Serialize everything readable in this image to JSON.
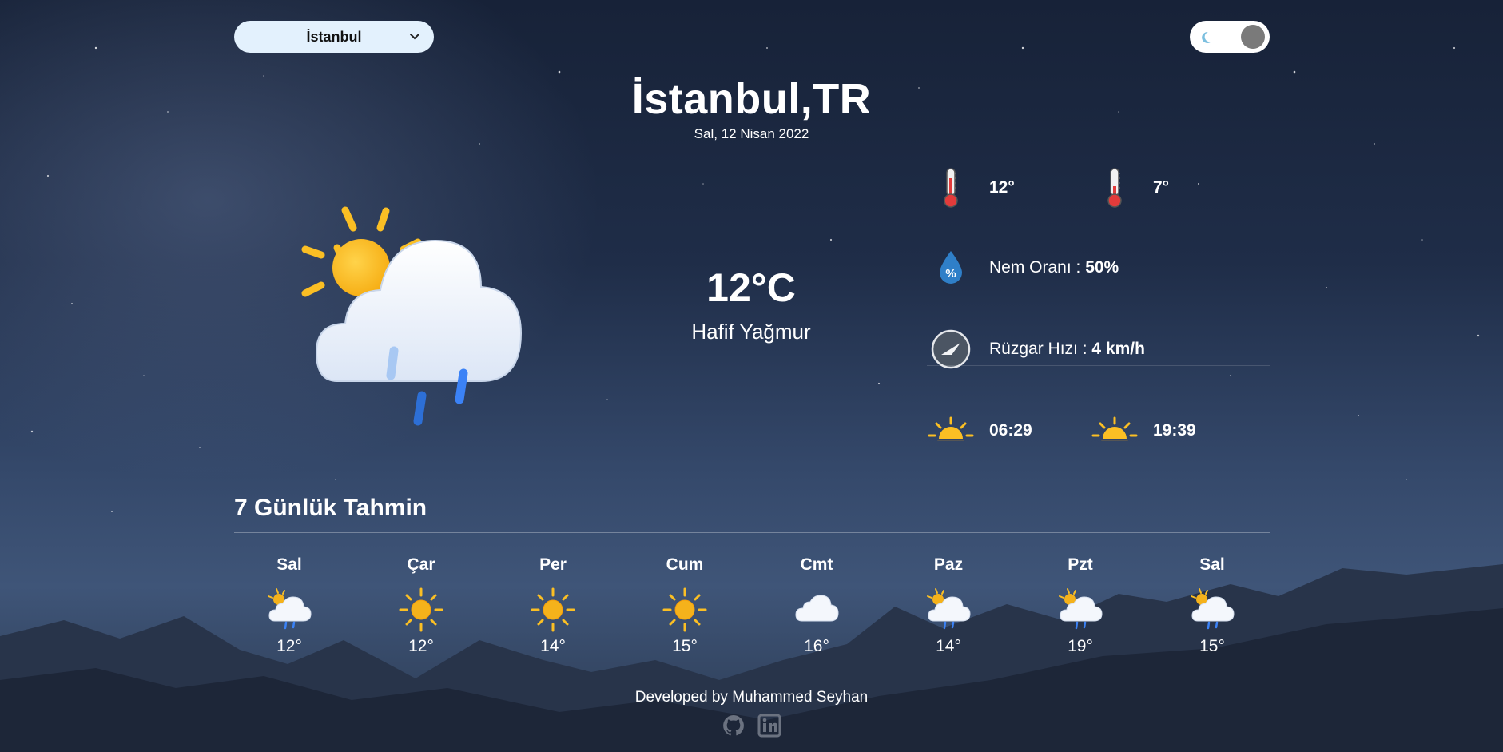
{
  "city_select": {
    "value": "İstanbul",
    "icon": "chevron-down-icon"
  },
  "theme_toggle": {
    "icon": "moon-icon"
  },
  "header": {
    "title": "İstanbul,TR",
    "date": "Sal, 12 Nisan 2022"
  },
  "current": {
    "icon": "sun-cloud-rain-icon",
    "temp": "12°C",
    "description": "Hafif Yağmur"
  },
  "details": {
    "temp_max": {
      "icon": "thermometer-icon",
      "value": "12°"
    },
    "temp_min": {
      "icon": "thermometer-icon",
      "value": "7°"
    },
    "humidity": {
      "icon": "humidity-drop-icon",
      "label": "Nem Oranı : ",
      "value": "50%"
    },
    "wind": {
      "icon": "wind-direction-icon",
      "label": "Rüzgar Hızı : ",
      "value": "4 km/h"
    },
    "sunrise": {
      "icon": "sunrise-icon",
      "value": "06:29"
    },
    "sunset": {
      "icon": "sunset-icon",
      "value": "19:39"
    }
  },
  "forecast": {
    "title": "7 Günlük Tahmin",
    "days": [
      {
        "day": "Sal",
        "icon": "sun-cloud-rain-icon",
        "temp": "12°"
      },
      {
        "day": "Çar",
        "icon": "sun-icon",
        "temp": "12°"
      },
      {
        "day": "Per",
        "icon": "sun-icon",
        "temp": "14°"
      },
      {
        "day": "Cum",
        "icon": "sun-icon",
        "temp": "15°"
      },
      {
        "day": "Cmt",
        "icon": "cloud-icon",
        "temp": "16°"
      },
      {
        "day": "Paz",
        "icon": "sun-cloud-rain-icon",
        "temp": "14°"
      },
      {
        "day": "Pzt",
        "icon": "sun-cloud-rain-icon",
        "temp": "19°"
      },
      {
        "day": "Sal",
        "icon": "sun-cloud-rain-icon",
        "temp": "15°"
      }
    ]
  },
  "footer": {
    "text": "Developed by Muhammed Seyhan",
    "links": [
      "github-icon",
      "linkedin-icon"
    ]
  },
  "colors": {
    "select_bg": "#e3f1fd",
    "sun": "#fbbf24",
    "rain": "#3b82f6",
    "thermometer": "#e23b3b",
    "drop": "#2f7fc8"
  }
}
